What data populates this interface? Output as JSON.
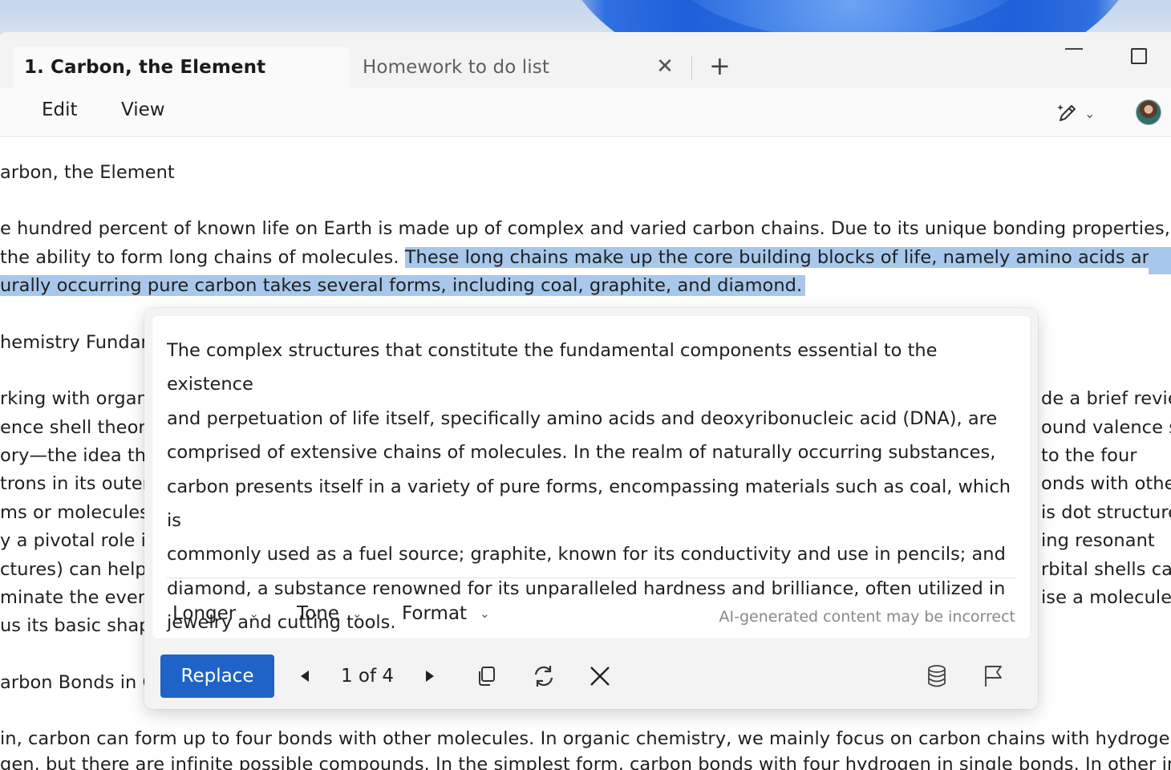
{
  "tabs": [
    {
      "label": "1. Carbon, the Element",
      "active": true
    },
    {
      "label": "Homework to do list",
      "active": false
    }
  ],
  "menu": {
    "edit": "Edit",
    "view": "View"
  },
  "document": {
    "title": "arbon, the Element",
    "p1": [
      "e hundred percent of known life on Earth is made up of complex and varied carbon chains. Due to its unique bonding properties, carbo",
      "the ability to form long chains of molecules. ",
      "These long chains make up the core building blocks of life, namely amino acids and DNA. ",
      "urally occurring pure carbon takes several forms, including coal, graphite, and diamond."
    ],
    "heading2": "hemistry Fundan",
    "left_lines": [
      "rking with organi",
      "ence shell theory,",
      "ory—the idea tha",
      "trons in its outer",
      "ms or molecules.",
      "y a pivotal role in",
      "ctures) can help",
      "minate the event",
      "us its basic shap"
    ],
    "right_lines": [
      "de a brief revie",
      "ound valence sl",
      "to the four",
      "onds with othe",
      "is dot structure",
      "ing resonant",
      "rbital shells can",
      "ise a molecule"
    ],
    "heading3": "arbon Bonds in C",
    "p3": [
      "in, carbon can form up to four bonds with other molecules. In organic chemistry, we mainly focus on carbon chains with hydrogen and",
      "gen, but there are infinite possible compounds. In the simplest form, carbon bonds with four hydrogen in single bonds. In other instanc"
    ]
  },
  "rewrite": {
    "lines": [
      "The complex structures that constitute the fundamental components essential to the existence",
      "and perpetuation of life itself, specifically amino acids and deoxyribonucleic acid (DNA), are",
      "comprised of extensive chains of molecules. In the realm of naturally occurring substances,",
      "carbon presents itself in a variety of pure forms, encompassing materials such as coal, which is",
      "commonly used as a fuel source; graphite, known for its conductivity and use in pencils; and",
      "diamond, a substance renowned for its unparalleled hardness and brilliance, often utilized in",
      "jewelry and cutting tools."
    ],
    "options": {
      "length": "Longer",
      "tone": "Tone",
      "format": "Format"
    },
    "disclaimer": "AI-generated content may be incorrect",
    "replace_label": "Replace",
    "counter": "1 of 4"
  },
  "colors": {
    "accent": "#1f63c6",
    "highlight": "#a7c7ec"
  }
}
